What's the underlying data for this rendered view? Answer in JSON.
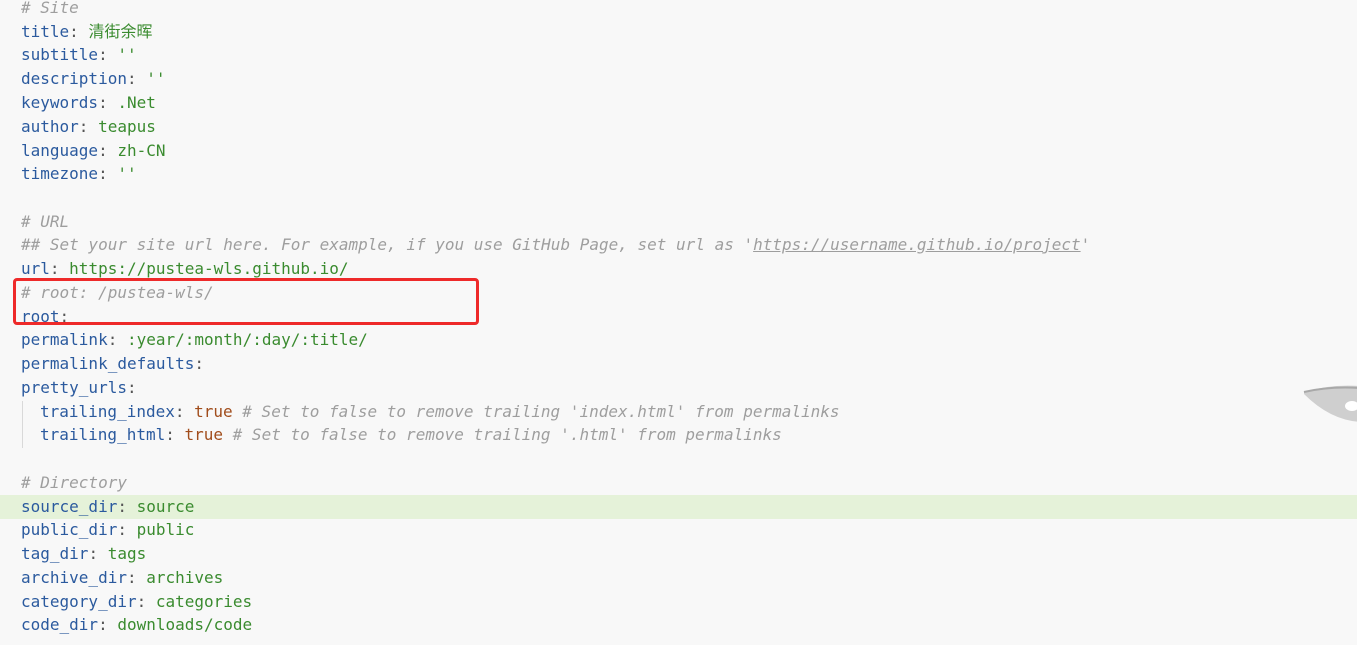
{
  "lines": [
    {
      "comment": "# Site"
    },
    {
      "key": "title",
      "sep": ": ",
      "val": "清街余晖"
    },
    {
      "key": "subtitle",
      "sep": ": ",
      "val": "''"
    },
    {
      "key": "description",
      "sep": ": ",
      "val": "''"
    },
    {
      "key": "keywords",
      "sep": ": ",
      "val": ".Net"
    },
    {
      "key": "author",
      "sep": ": ",
      "val": "teapus"
    },
    {
      "key": "language",
      "sep": ": ",
      "val": "zh-CN"
    },
    {
      "key": "timezone",
      "sep": ": ",
      "val": "''"
    },
    {
      "comment": "# URL"
    },
    {
      "comment_prefix": "## Set your site url here. For example, if you use GitHub Page, set url as '",
      "comment_url": "https://username.github.io/project",
      "comment_suffix": "'"
    },
    {
      "key": "url",
      "sep": ": ",
      "val": "https://pustea-wls.github.io/"
    },
    {
      "comment": "# root: /pustea-wls/"
    },
    {
      "key": "root",
      "sep": ":"
    },
    {
      "key": "permalink",
      "sep": ": ",
      "val": ":year/:month/:day/:title/"
    },
    {
      "key": "permalink_defaults",
      "sep": ":"
    },
    {
      "key": "pretty_urls",
      "sep": ":"
    },
    {
      "key": "trailing_index",
      "sep": ": ",
      "bool": "true",
      "trail": " # Set to false to remove trailing 'index.html' from permalinks"
    },
    {
      "key": "trailing_html",
      "sep": ": ",
      "bool": "true",
      "trail": " # Set to false to remove trailing '.html' from permalinks"
    },
    {
      "comment": "# Directory"
    },
    {
      "key": "source_dir",
      "sep": ": ",
      "val": "source"
    },
    {
      "key": "public_dir",
      "sep": ": ",
      "val": "public"
    },
    {
      "key": "tag_dir",
      "sep": ": ",
      "val": "tags"
    },
    {
      "key": "archive_dir",
      "sep": ": ",
      "val": "archives"
    },
    {
      "key": "category_dir",
      "sep": ": ",
      "val": "categories"
    },
    {
      "key": "code_dir",
      "sep": ": ",
      "val": "downloads/code"
    }
  ],
  "colors": {
    "highlight": "#e5f2d9",
    "redbox": "#ee2a2a",
    "key": "#2b5a9e",
    "value": "#3a8b2f",
    "comment": "#9e9e9e",
    "bool": "#a14d1c"
  }
}
